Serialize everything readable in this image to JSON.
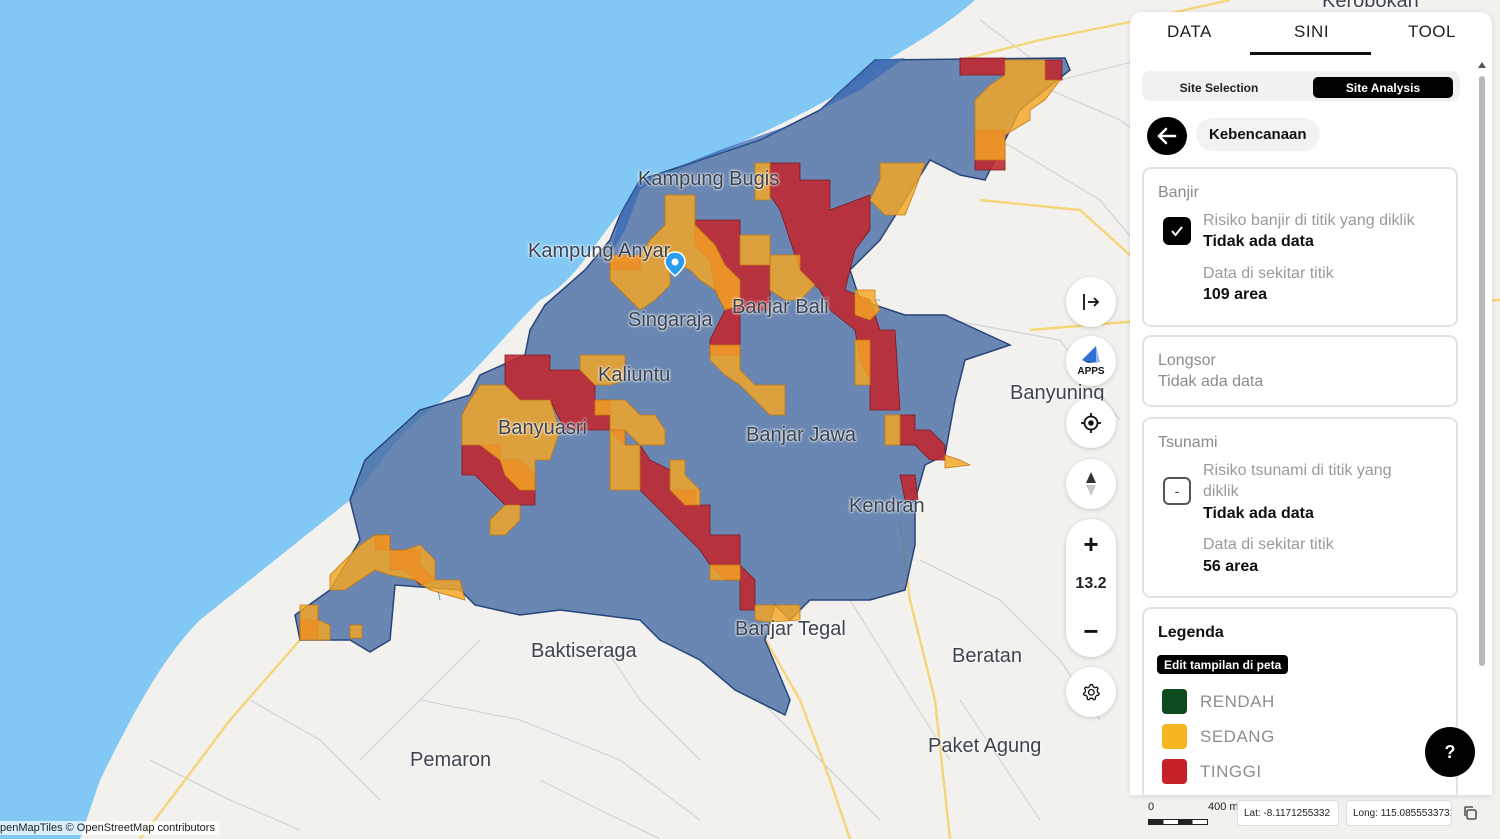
{
  "map": {
    "place_labels": [
      {
        "name": "Kampung Bugis"
      },
      {
        "name": "Kampung Anyar"
      },
      {
        "name": "Banjar Bali"
      },
      {
        "name": "Singaraja"
      },
      {
        "name": "Kaliuntu"
      },
      {
        "name": "Banyuasri"
      },
      {
        "name": "Banjar Jawa"
      },
      {
        "name": "Banyuning"
      },
      {
        "name": "Kendran"
      },
      {
        "name": "Banjar Tegal"
      },
      {
        "name": "Baktiseraga"
      },
      {
        "name": "Beratan"
      },
      {
        "name": "Paket Agung"
      },
      {
        "name": "Pemaron"
      },
      {
        "name": "Kerobokan"
      }
    ],
    "attribution": "penMapTiles © OpenStreetMap contributors",
    "scale": {
      "zero": "0",
      "distance": "400 m"
    },
    "coordinates": {
      "lat": "Lat: -8.1171255332",
      "long": "Long: 115.0855533731"
    },
    "colors": {
      "sea": "#82c8f5",
      "region_fill": "#4a6fa5",
      "tinggi": "#c0272d",
      "sedang": "#f5a623",
      "rendah": "#0d4a1e"
    }
  },
  "controls": {
    "sidebar_toggle_icon": "collapse-right-icon",
    "apps_label": "APPS",
    "locate_icon": "crosshair-icon",
    "compass_icon": "compass-icon",
    "zoom_in": "+",
    "zoom_level": "13.2",
    "zoom_out": "−",
    "settings_icon": "gear-icon",
    "help": "?"
  },
  "panel": {
    "tabs": [
      {
        "label": "DATA",
        "active": false
      },
      {
        "label": "SINI",
        "active": true
      },
      {
        "label": "TOOL",
        "active": false
      }
    ],
    "segments": [
      {
        "label": "Site Selection",
        "active": false
      },
      {
        "label": "Site Analysis",
        "active": true
      }
    ],
    "back_icon": "arrow-left-icon",
    "category": "Kebencanaan",
    "banjir": {
      "title": "Banjir",
      "checked": true,
      "risk_label": "Risiko banjir di titik yang diklik",
      "risk_value": "Tidak ada data",
      "around_label": "Data di sekitar titik",
      "around_value": "109 area"
    },
    "longsor": {
      "title": "Longsor",
      "status": "Tidak ada data"
    },
    "tsunami": {
      "title": "Tsunami",
      "checked": false,
      "checkbox_symbol": "-",
      "risk_label_line1": "Risiko tsunami di titik yang",
      "risk_label_line2": "diklik",
      "risk_value": "Tidak ada data",
      "around_label": "Data di sekitar titik",
      "around_value": "56 area"
    },
    "legend": {
      "title": "Legenda",
      "edit_button": "Edit tampilan di peta",
      "items": [
        {
          "label": "RENDAH",
          "color": "#0d4a1e"
        },
        {
          "label": "SEDANG",
          "color": "#f5b622"
        },
        {
          "label": "TINGGI",
          "color": "#c62128"
        }
      ]
    }
  }
}
